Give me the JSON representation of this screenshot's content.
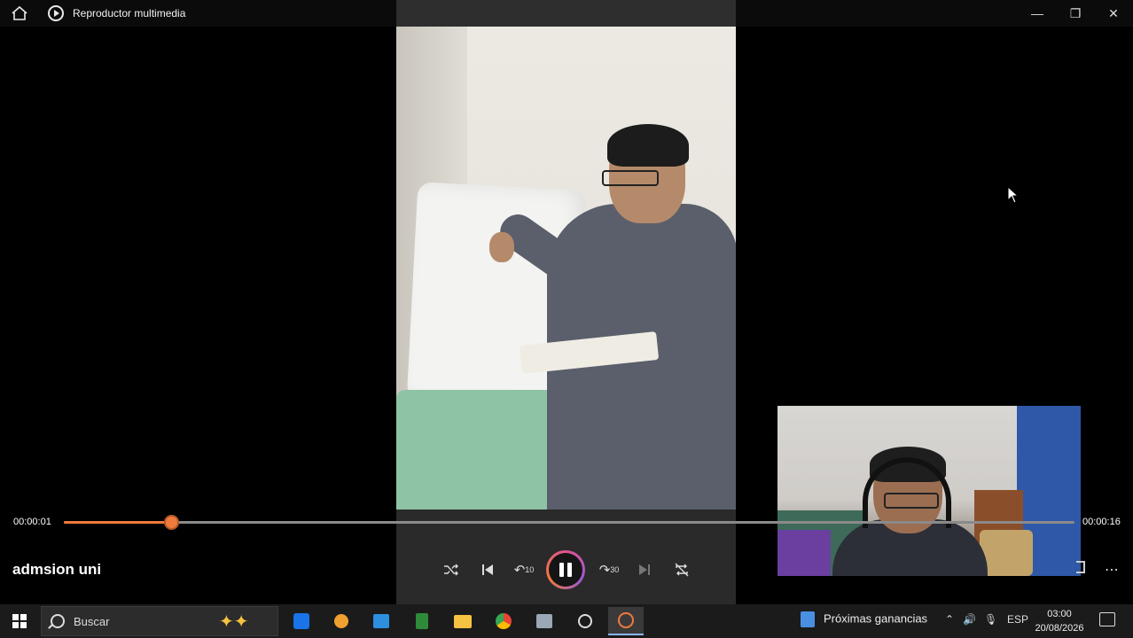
{
  "window": {
    "title": "Reproductor multimedia"
  },
  "player": {
    "media_title": "admsion uni",
    "current_time": "00:00:01",
    "total_time": "00:00:16",
    "progress_percent": 10.6,
    "skip_back_label": "10",
    "skip_forward_label": "30"
  },
  "taskbar": {
    "search_placeholder": "Buscar",
    "news_label": "Próximas ganancias",
    "language": "ESP",
    "time": "03:00",
    "date": "20/08/2026"
  },
  "colors": {
    "accent": "#f07a3c",
    "taskbar_bg": "#1b1b1b"
  }
}
